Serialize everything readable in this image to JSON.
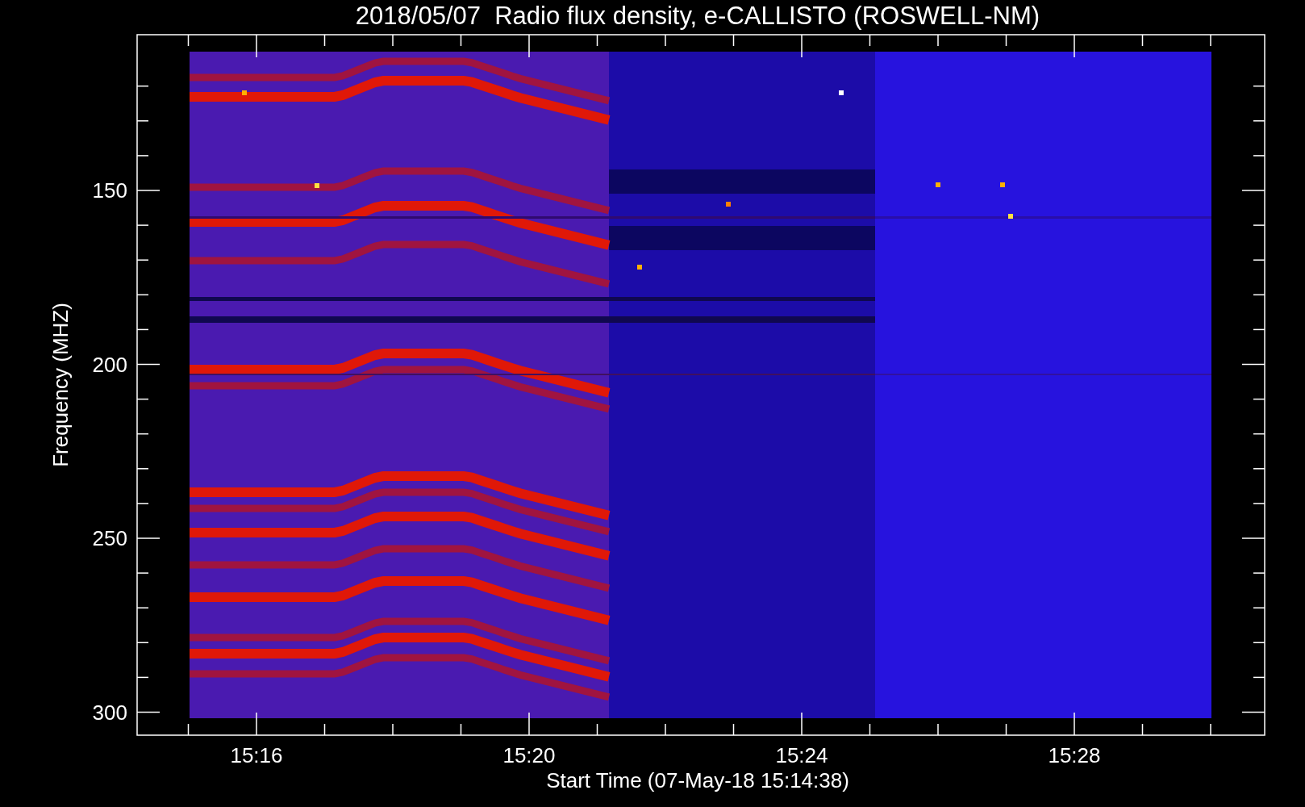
{
  "title": "2018/05/07  Radio flux density, e-CALLISTO (ROSWELL-NM)",
  "y_axis": {
    "label": "Frequency (MHZ)",
    "ticks": [
      "150",
      "200",
      "250",
      "300"
    ]
  },
  "x_axis": {
    "label": "Start Time (07-May-18 15:14:38)",
    "ticks": [
      "15:16",
      "15:20",
      "15:24",
      "15:28"
    ]
  }
}
